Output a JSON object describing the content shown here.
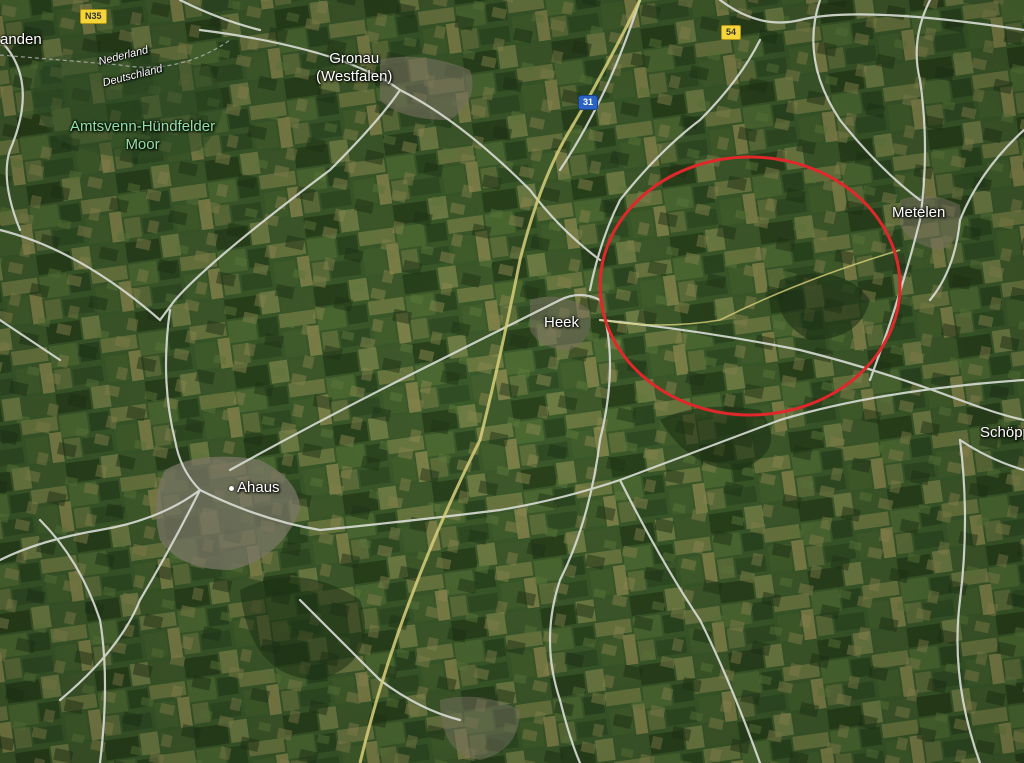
{
  "map": {
    "type": "satellite",
    "colors": {
      "terrain_base": "#3a5a2a",
      "field_light": "#6b7a3e",
      "field_dark": "#24381a",
      "road": "#d9ddd6",
      "motorway": "#d8cf7a",
      "highlight_circle": "#e0282b"
    },
    "places": {
      "gronau": "Gronau\n(Westfalen)",
      "heek": "Heek",
      "ahaus": "Ahaus",
      "metelen": "Metelen",
      "schoppingen": "Schöpp",
      "landen": "anden",
      "nature_reserve": "Amtsvenn-Hündfelder\nMoor",
      "border_nl": "Nederland",
      "border_de": "Deutschland"
    },
    "route_shields": {
      "n35": "N35",
      "r54": "54",
      "a31": "31"
    },
    "annotation": {
      "shape": "red-circle",
      "description_color": "#e0282b"
    }
  }
}
